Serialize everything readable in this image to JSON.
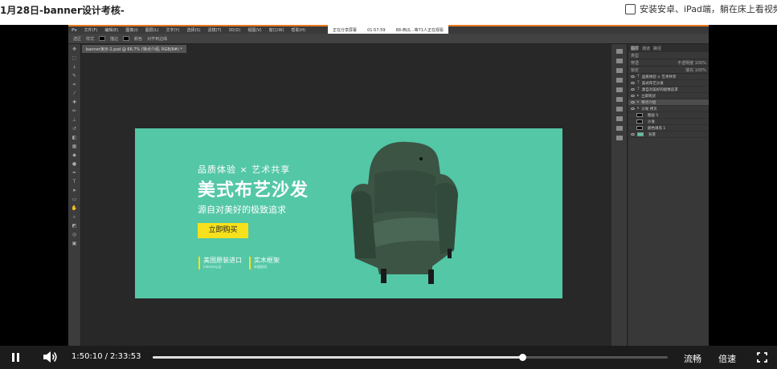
{
  "page": {
    "title": "1月28日-banner设计考核-",
    "app_promo": "安装安卓、iPad端，躺在床上看视频"
  },
  "photoshop": {
    "menu": [
      "文件(F)",
      "编辑(E)",
      "图像(I)",
      "图层(L)",
      "文字(Y)",
      "选择(S)",
      "滤镜(T)",
      "3D(D)",
      "视图(V)",
      "窗口(W)",
      "帮助(H)"
    ],
    "options": [
      "选区",
      "样式",
      "描边",
      "颜色",
      "对齐到边缘"
    ],
    "recording_overlay": {
      "left": "正在分享屏幕",
      "mid": "01:57:59",
      "right": "88-西瓜...等71人正在观看"
    },
    "doc_tab": "banner演示-2.psd @ 66.7% (特点介绍, RGB/8#) *",
    "tools": [
      "move-tool",
      "marquee-tool",
      "lasso-tool",
      "quick-select-tool",
      "crop-tool",
      "eyedropper-tool",
      "healing-tool",
      "brush-tool",
      "stamp-tool",
      "history-brush-tool",
      "eraser-tool",
      "gradient-tool",
      "blur-tool",
      "dodge-tool",
      "pen-tool",
      "type-tool",
      "path-select-tool",
      "shape-tool",
      "hand-tool",
      "zoom-tool",
      "color-swatches",
      "quick-mask-tool",
      "screen-mode-tool"
    ],
    "panel_tabs": [
      "图层",
      "通道",
      "路径"
    ],
    "panel_controls": {
      "kind": "类型",
      "blend": "穿透",
      "opacity_label": "不透明度",
      "opacity": "100%",
      "lock_label": "锁定",
      "fill_label": "填充",
      "fill": "100%"
    },
    "layers": [
      {
        "kind": "T",
        "name": "品质体验 × 艺术共享"
      },
      {
        "kind": "T",
        "name": "美式布艺沙发"
      },
      {
        "kind": "T",
        "name": "源自对美好的极致追求"
      },
      {
        "kind": "▸",
        "name": "立即购买"
      },
      {
        "kind": "▸",
        "name": "特点介绍"
      },
      {
        "kind": "▾",
        "name": "沙发 拷贝"
      },
      {
        "kind": "",
        "name": "图层 5"
      },
      {
        "kind": "",
        "name": "沙发"
      },
      {
        "kind": "",
        "name": "颜色填充 1"
      },
      {
        "kind": "",
        "name": "背景"
      }
    ]
  },
  "banner": {
    "headline": "品质体验 × 艺术共享",
    "title": "美式布艺沙发",
    "subtitle": "源自对美好的极致追求",
    "cta": "立即购买",
    "features": [
      {
        "title": "美国原装进口",
        "sub": "interior认证"
      },
      {
        "title": "实木框架",
        "sub": "牢固耐用"
      }
    ],
    "colors": {
      "background": "#54c7a6",
      "cta": "#f7e11c",
      "sofa": "#3b5444"
    }
  },
  "player": {
    "current_time": "1:50:10",
    "separator": "/",
    "duration": "2:33:53",
    "progress": 0.717,
    "quality_label": "流畅",
    "speed_label": "倍速"
  }
}
